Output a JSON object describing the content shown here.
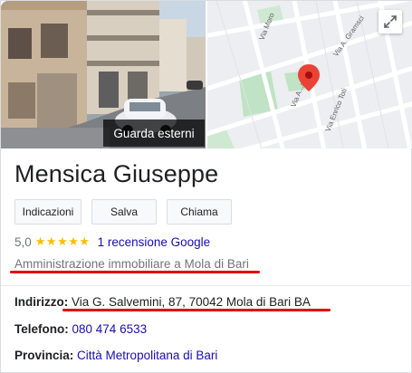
{
  "media": {
    "street_view_label": "Guarda esterni",
    "expand_icon": "expand-icon",
    "map_labels": [
      "Via Moro",
      "Via A. Gramsci",
      "Via A...asperi",
      "Via Enrico Toti"
    ]
  },
  "business": {
    "name": "Mensica Giuseppe",
    "actions": [
      "Indicazioni",
      "Salva",
      "Chiama"
    ],
    "rating_value": "5,0",
    "stars": "★★★★★",
    "reviews_label": "1 recensione Google",
    "category": "Amministrazione immobiliare a Mola di Bari"
  },
  "details": {
    "address_label": "Indirizzo:",
    "address_value": "Via G. Salvemini, 87, 70042 Mola di Bari BA",
    "phone_label": "Telefono:",
    "phone_value": "080 474 6533",
    "province_label": "Provincia:",
    "province_value": "Città Metropolitana di Bari"
  },
  "colors": {
    "link": "#1a0dab",
    "star": "#fbbc04",
    "annotation": "#e00000",
    "map_pin": "#ea4335"
  }
}
